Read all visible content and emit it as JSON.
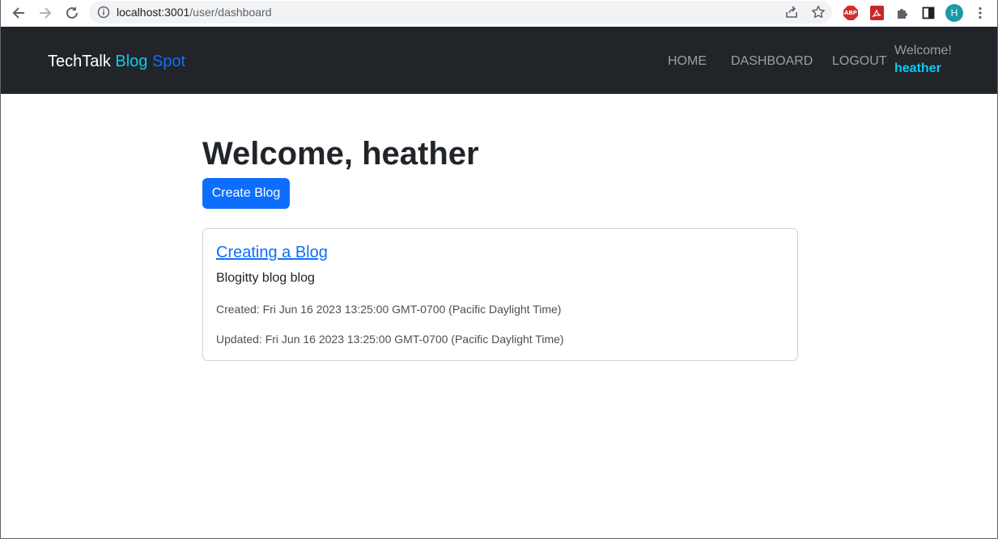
{
  "browser": {
    "url_host": "localhost:3001",
    "url_path": "/user/dashboard",
    "abp_label": "ABP",
    "profile_initial": "H"
  },
  "navbar": {
    "brand_part1": "TechTalk",
    "brand_part2": "Blog",
    "brand_part3": "Spot",
    "links": [
      {
        "label": "HOME"
      },
      {
        "label": "DASHBOARD"
      },
      {
        "label": "LOGOUT"
      }
    ],
    "welcome_label": "Welcome!",
    "welcome_user": "heather"
  },
  "main": {
    "title": "Welcome, heather",
    "create_button": "Create Blog"
  },
  "posts": [
    {
      "title": "Creating a Blog",
      "body": "Blogitty blog blog",
      "created": "Created: Fri Jun 16 2023 13:25:00 GMT-0700 (Pacific Daylight Time)",
      "updated": "Updated: Fri Jun 16 2023 13:25:00 GMT-0700 (Pacific Daylight Time)"
    }
  ],
  "colors": {
    "navbar_bg": "#212529",
    "accent_cyan": "#0dcaf0",
    "primary_blue": "#0d6efd"
  }
}
